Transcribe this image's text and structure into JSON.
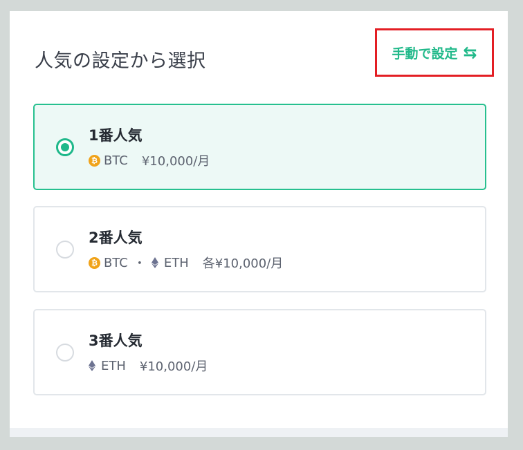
{
  "header": {
    "title": "人気の設定から選択",
    "manual_label": "手動で設定",
    "manual_icon": "swap-arrows-icon"
  },
  "colors": {
    "accent": "#1fb88a",
    "highlight_border": "#e31e24",
    "btc": "#f0a31a",
    "eth": "#6d7391"
  },
  "options": [
    {
      "title": "1番人気",
      "selected": true,
      "coin1": "BTC",
      "price": "¥10,000/月"
    },
    {
      "title": "2番人気",
      "selected": false,
      "coin1": "BTC",
      "separator": "・",
      "coin2": "ETH",
      "price": "各¥10,000/月"
    },
    {
      "title": "3番人気",
      "selected": false,
      "coin1": "ETH",
      "price": "¥10,000/月"
    }
  ]
}
